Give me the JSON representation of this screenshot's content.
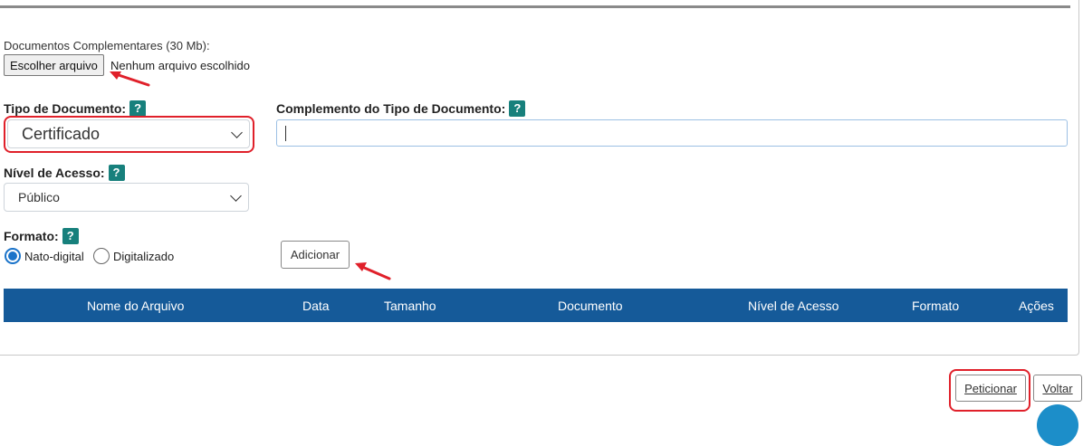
{
  "attachments": {
    "label": "Documentos Complementares (30 Mb):",
    "choose_button": "Escolher arquivo",
    "no_file_text": "Nenhum arquivo escolhido"
  },
  "document_type": {
    "label": "Tipo de Documento:",
    "help": "?",
    "selected": "Certificado"
  },
  "type_complement": {
    "label": "Complemento do Tipo de Documento:",
    "help": "?",
    "value": ""
  },
  "access_level": {
    "label": "Nível de Acesso:",
    "help": "?",
    "selected": "Público"
  },
  "format": {
    "label": "Formato:",
    "help": "?",
    "options": [
      "Nato-digital",
      "Digitalizado"
    ],
    "selected": "Nato-digital"
  },
  "add_button": "Adicionar",
  "table": {
    "columns": [
      "Nome do Arquivo",
      "Data",
      "Tamanho",
      "Documento",
      "Nível de Acesso",
      "Formato",
      "Ações"
    ],
    "rows": []
  },
  "footer": {
    "submit_button": "Peticionar",
    "back_button": "Voltar"
  },
  "colors": {
    "header_bg": "#155a99",
    "help_badge": "#17807c",
    "annotation_red": "#e0202a",
    "radio_accent": "#1a73c9"
  }
}
